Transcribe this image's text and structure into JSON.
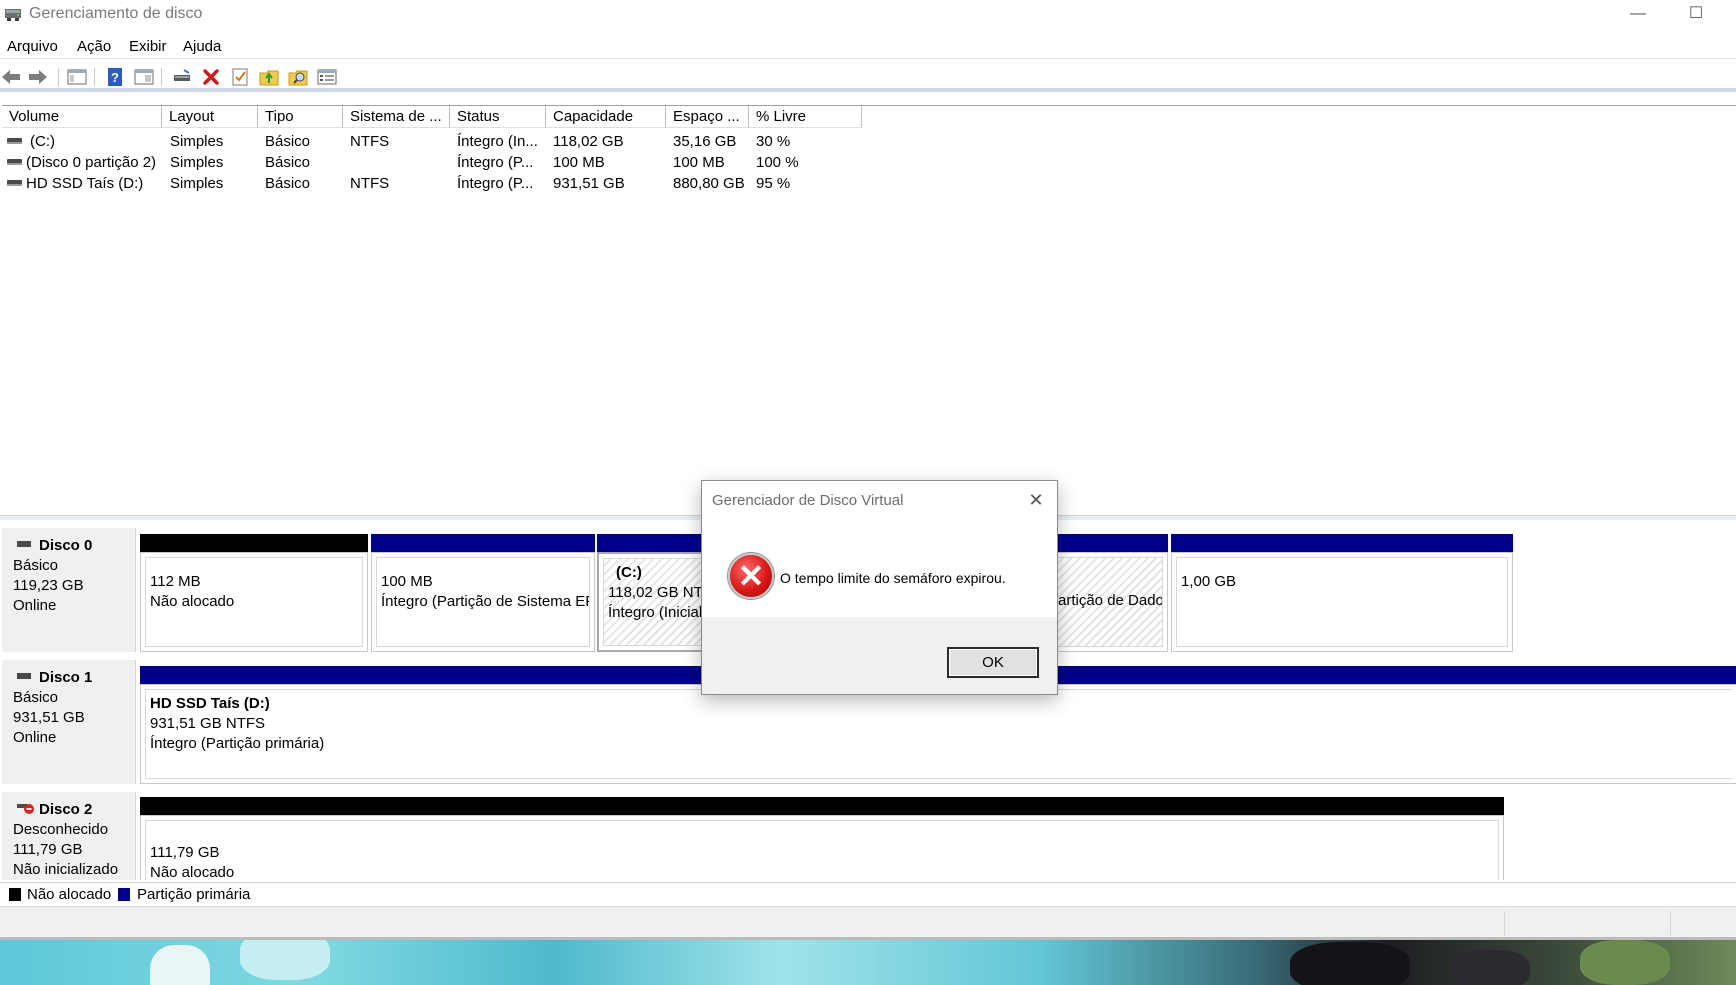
{
  "window": {
    "title": "Gerenciamento de disco",
    "minimize_glyph": "—",
    "maximize_glyph": "☐"
  },
  "menu": {
    "items": [
      "Arquivo",
      "Ação",
      "Exibir",
      "Ajuda"
    ]
  },
  "toolbar": {
    "icons": [
      "back-arrow-icon",
      "forward-arrow-icon",
      "console-tree-icon",
      "help-icon",
      "properties-pane-icon",
      "connect-disk-icon",
      "delete-icon",
      "check-icon",
      "up-folder-icon",
      "search-folder-icon",
      "properties-icon"
    ]
  },
  "volumes": {
    "columns": [
      "Volume",
      "Layout",
      "Tipo",
      "Sistema de ...",
      "Status",
      "Capacidade",
      "Espaço ...",
      "% Livre"
    ],
    "rows": [
      [
        "(C:)",
        "Simples",
        "Básico",
        "NTFS",
        "Íntegro (In...",
        "118,02 GB",
        "35,16 GB",
        "30 %"
      ],
      [
        "(Disco 0 partição 2)",
        "Simples",
        "Básico",
        "",
        "Íntegro (P...",
        "100 MB",
        "100 MB",
        "100 %"
      ],
      [
        "HD SSD Taís (D:)",
        "Simples",
        "Básico",
        "NTFS",
        "Íntegro (P...",
        "931,51 GB",
        "880,80 GB",
        "95 %"
      ]
    ]
  },
  "disks": [
    {
      "name": "Disco 0",
      "type": "Básico",
      "size": "119,23 GB",
      "state": "Online",
      "partitions": [
        {
          "line1": "112 MB",
          "line2": "Não alocado",
          "kind": "unallocated"
        },
        {
          "line1": "100 MB",
          "line2": "Íntegro (Partição de Sistema EF",
          "kind": "primary"
        },
        {
          "title": "(C:)",
          "line1": "118,02 GB NTFS",
          "line2": "Íntegro (Inicial",
          "kind": "primary"
        },
        {
          "line2": "artição de Dado",
          "kind": "primary"
        },
        {
          "line1": "1,00 GB",
          "kind": "primary"
        }
      ]
    },
    {
      "name": "Disco 1",
      "type": "Básico",
      "size": "931,51 GB",
      "state": "Online",
      "partitions": [
        {
          "title": "HD SSD Taís  (D:)",
          "line1": "931,51 GB NTFS",
          "line2": "Íntegro (Partição primária)",
          "kind": "primary"
        }
      ]
    },
    {
      "name": "Disco 2",
      "type": "Desconhecido",
      "size": "111,79 GB",
      "state": "Não inicializado",
      "partitions": [
        {
          "line1": "111,79 GB",
          "line2": "Não alocado",
          "kind": "unallocated"
        }
      ]
    }
  ],
  "legend": {
    "unallocated": "Não alocado",
    "primary": "Partição primária"
  },
  "colors": {
    "unallocated": "#000000",
    "primary": "#00008b",
    "disk_label_bg": "#f0f0f0"
  },
  "dialog": {
    "title": "Gerenciador de Disco Virtual",
    "message": "O tempo limite do semáforo expirou.",
    "ok_label": "OK",
    "close_glyph": "✕",
    "icon": "error-icon",
    "icon_glyph": "✕"
  }
}
